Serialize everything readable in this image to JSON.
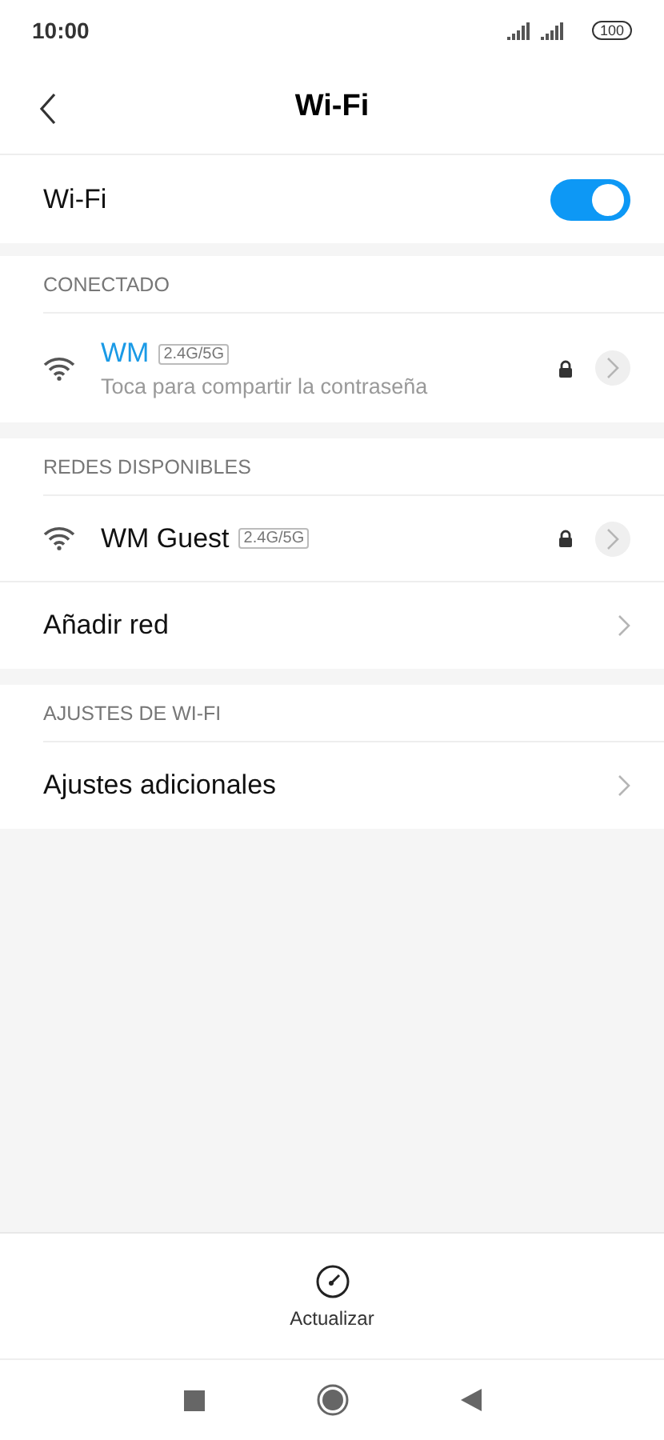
{
  "status_bar": {
    "time": "10:00",
    "battery": "100"
  },
  "header": {
    "title": "Wi-Fi"
  },
  "wifi_toggle": {
    "label": "Wi-Fi",
    "on": true
  },
  "sections": [
    {
      "title": "CONECTADO",
      "items": [
        {
          "kind": "network",
          "name": "WM",
          "band": "2.4G/5G",
          "subtitle": "Toca para compartir la contraseña",
          "connected": true,
          "locked": true
        }
      ]
    },
    {
      "title": "REDES DISPONIBLES",
      "items": [
        {
          "kind": "network",
          "name": "WM Guest",
          "band": "2.4G/5G",
          "connected": false,
          "locked": true
        },
        {
          "kind": "link",
          "label": "Añadir red"
        }
      ]
    },
    {
      "title": "AJUSTES DE WI-FI",
      "items": [
        {
          "kind": "link",
          "label": "Ajustes adicionales"
        }
      ]
    }
  ],
  "bottom_action": {
    "label": "Actualizar"
  }
}
